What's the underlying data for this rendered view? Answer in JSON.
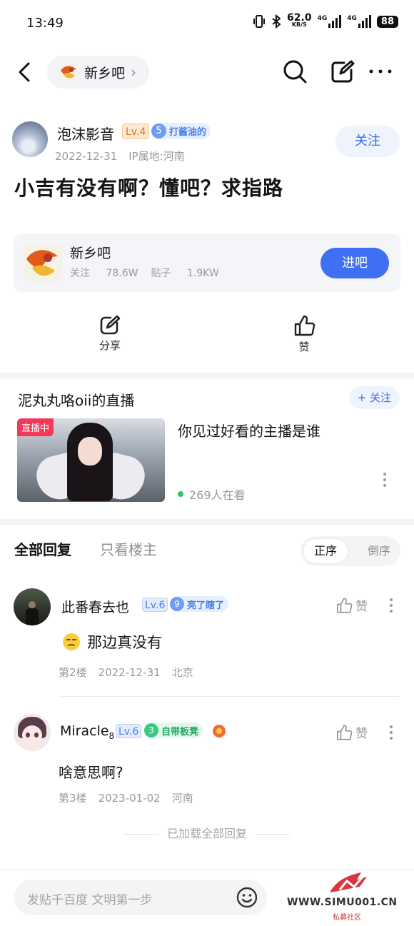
{
  "status_bar": {
    "time": "13:49",
    "net_speed": "62.0",
    "net_unit": "KB/S",
    "sig1": "4G",
    "sig2": "4G",
    "battery": "88"
  },
  "nav": {
    "forum_name": "新乡吧",
    "chevron": "›"
  },
  "author": {
    "name": "泡沫影音",
    "level": "Lv.4",
    "honor_num": "5",
    "honor_title": "打酱油的",
    "date": "2022-12-31",
    "ip": "IP属地:河南",
    "follow": "关注"
  },
  "post": {
    "title": "小吉有没有啊？懂吧？求指路"
  },
  "forum_card": {
    "name": "新乡吧",
    "followers_label": "关注",
    "followers": "78.6W",
    "posts_label": "贴子",
    "posts": "1.9KW",
    "enter": "进吧"
  },
  "actions": {
    "share": "分享",
    "like": "赞"
  },
  "live": {
    "title": "泥丸丸咯oii的直播",
    "follow": "+ 关注",
    "badge": "直播中",
    "headline": "你见过好看的主播是谁",
    "viewers": "269人在看"
  },
  "replies": {
    "tab_all": "全部回复",
    "tab_owner": "只看楼主",
    "sort_asc": "正序",
    "sort_desc": "倒序",
    "items": [
      {
        "name": "此番春去也",
        "level": "Lv.6",
        "honor_num": "9",
        "honor_title": "亮了瞎了",
        "like": "赞",
        "text": "那边真没有",
        "floor": "第2楼",
        "date": "2022-12-31",
        "location": "北京",
        "honor_color": "#6f9df5",
        "honor_bg": "#e5f0ff",
        "honor_text_color": "#4a7fe4"
      },
      {
        "name": "Miracle",
        "name_sub": "8",
        "level": "Lv.6",
        "honor_num": "3",
        "honor_title": "自带板凳",
        "like": "赞",
        "text": "啥意思啊?",
        "floor": "第3楼",
        "date": "2023-01-02",
        "location": "河南",
        "honor_color": "#3cc785",
        "honor_bg": "#e3f8ec",
        "honor_text_color": "#23a55f"
      }
    ],
    "loaded_all": "已加载全部回复"
  },
  "bottom": {
    "placeholder": "发贴千百度 文明第一步"
  },
  "watermark": {
    "brand": "WWW.SIMU001.CN",
    "sub": "私募社区"
  }
}
